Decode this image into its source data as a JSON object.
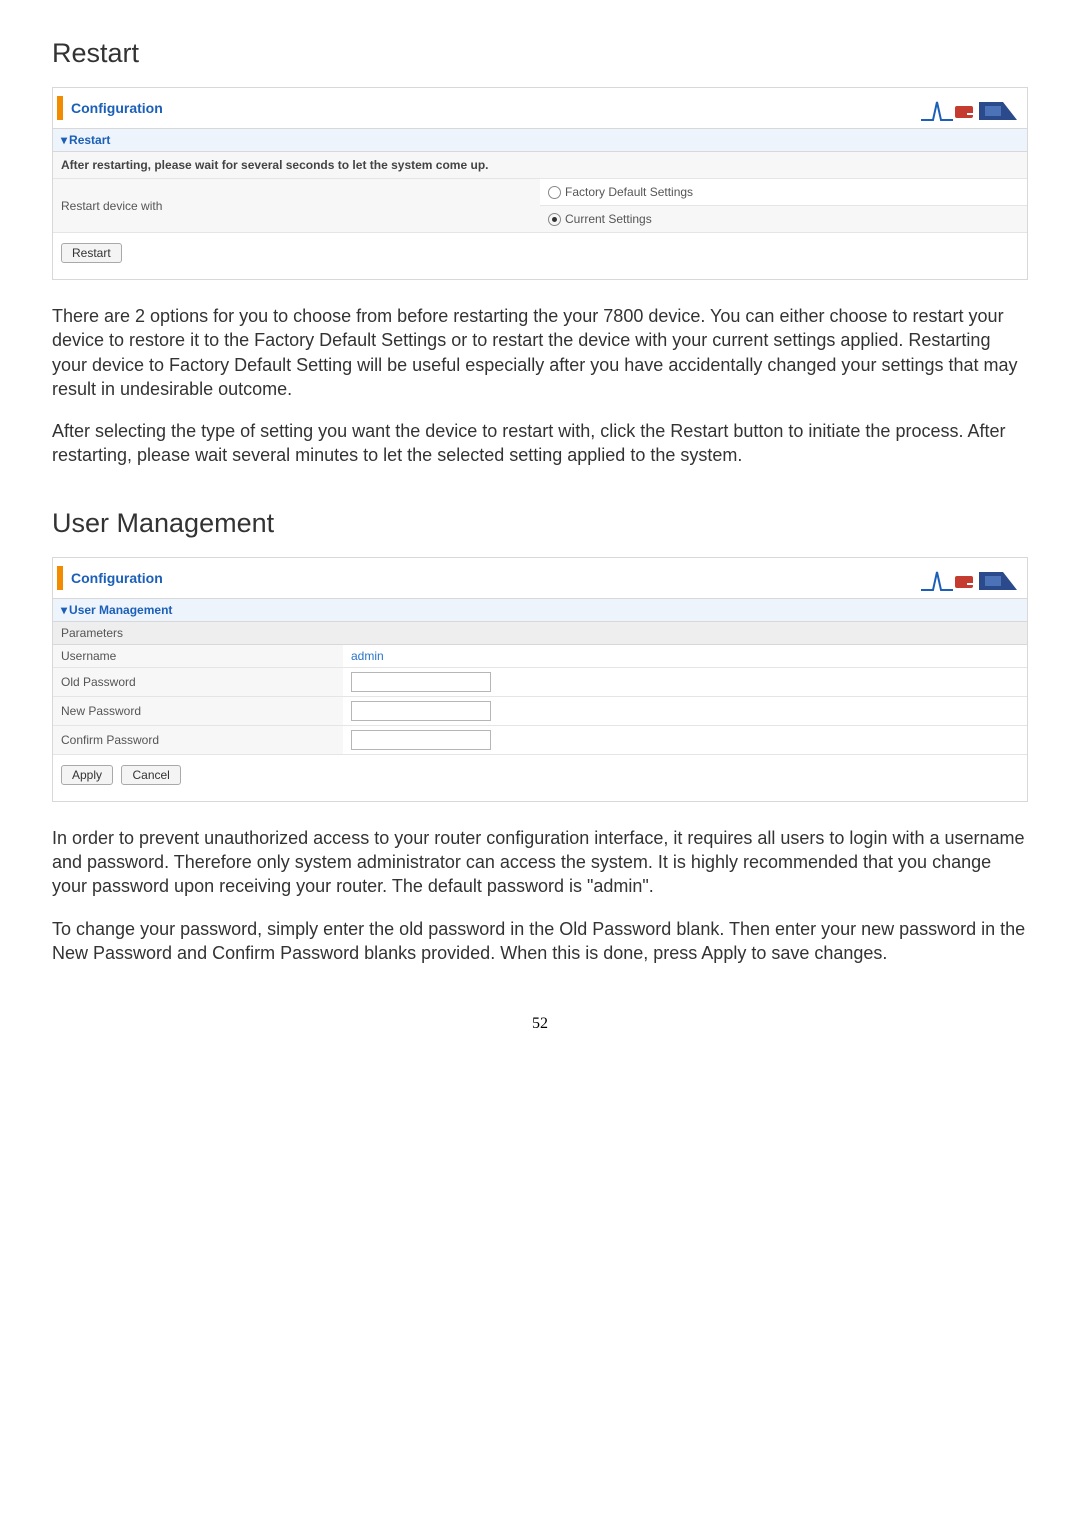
{
  "sections": {
    "restart": {
      "heading": "Restart",
      "panel_title": "Configuration",
      "sub_title": "Restart",
      "info_text": "After restarting, please wait for several seconds to let the system come up.",
      "row_label": "Restart device with",
      "options": {
        "factory": "Factory Default Settings",
        "current": "Current Settings"
      },
      "restart_btn": "Restart",
      "para1": "There are 2 options for you to choose from before restarting the your 7800 device. You can either choose to restart your device to restore it to the Factory Default Settings or to restart the device with your current settings applied. Restarting your device to Factory Default Setting will be useful especially after you have accidentally changed your settings that may result in undesirable outcome.",
      "para2": "After selecting the type of setting you want the device to restart with, click the Restart button to initiate the process. After restarting, please wait several minutes to let the selected setting applied to the system."
    },
    "user_mgmt": {
      "heading": "User Management",
      "panel_title": "Configuration",
      "sub_title": "User Management",
      "params_header": "Parameters",
      "rows": {
        "username_label": "Username",
        "username_value": "admin",
        "old_pw": "Old Password",
        "new_pw": "New Password",
        "confirm_pw": "Confirm Password"
      },
      "apply_btn": "Apply",
      "cancel_btn": "Cancel",
      "para1": "In order to prevent unauthorized access to your router configuration interface, it requires all users to login with a username and password. Therefore only system administrator can access the system. It is highly recommended that you change your password upon receiving your router. The default password is \"admin\".",
      "para2": "To change your password, simply enter the old password in the Old Password blank. Then enter your new password in the New Password and Confirm Password blanks provided. When this is done, press Apply to save changes."
    }
  },
  "page_number": "52"
}
